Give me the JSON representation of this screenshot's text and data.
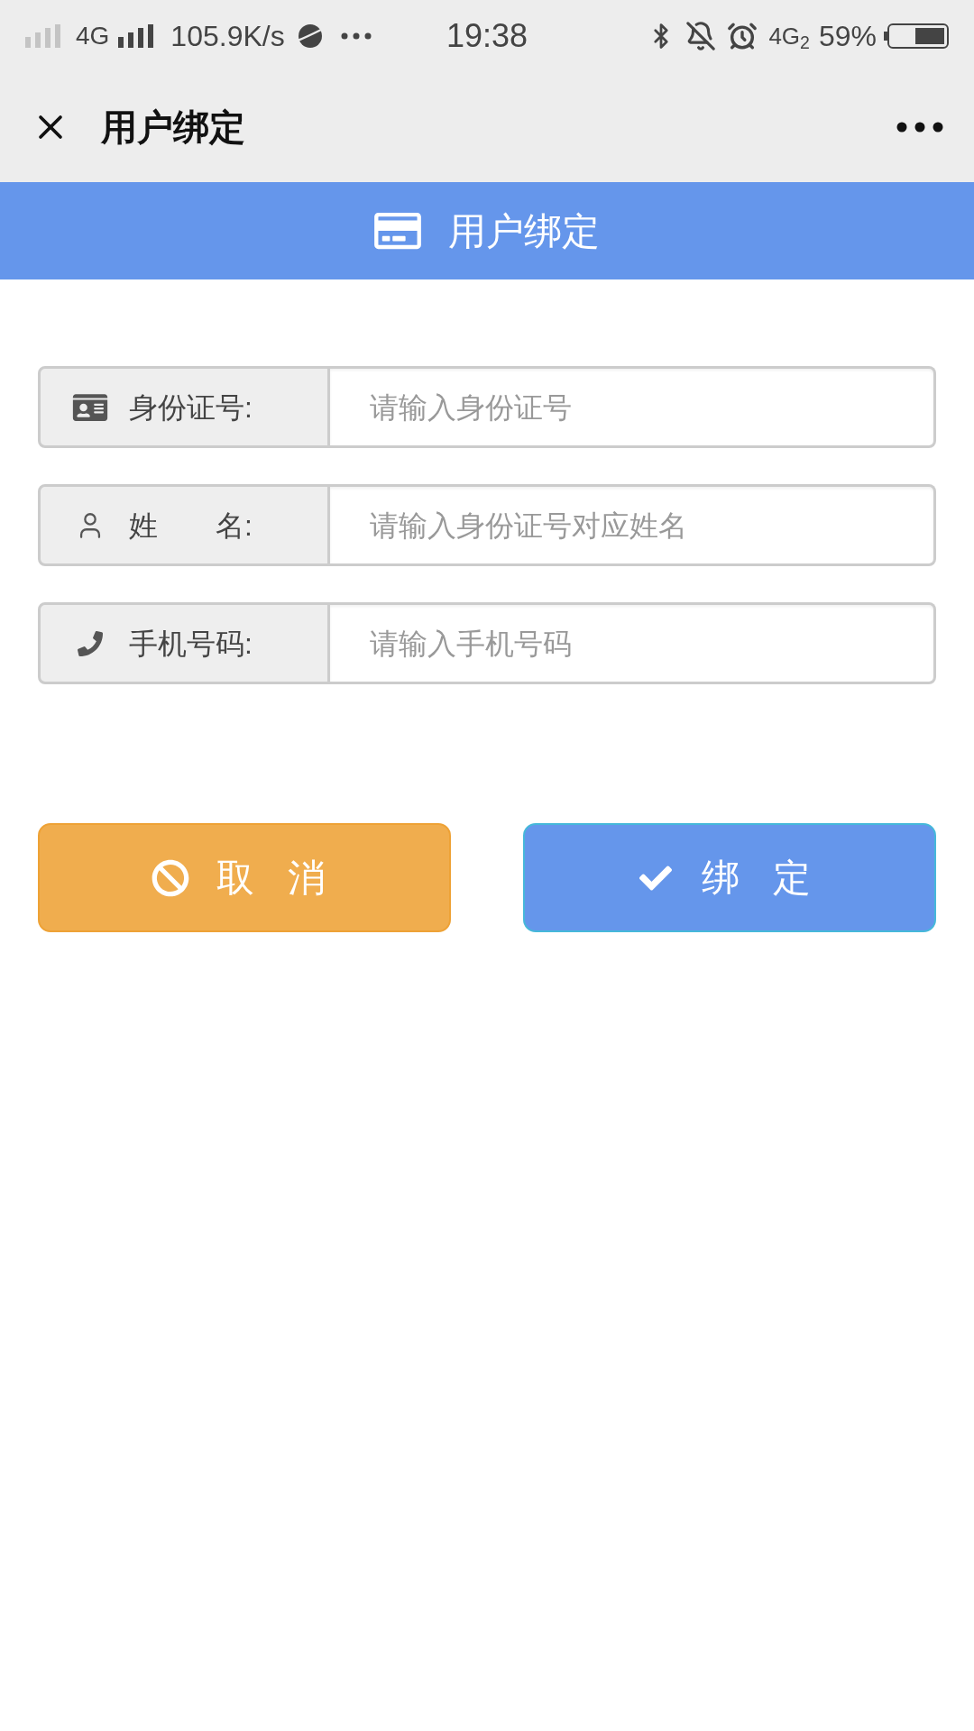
{
  "status_bar": {
    "network_1": "4G",
    "speed": "105.9K/s",
    "time": "19:38",
    "network_2": "4G$_{2}$",
    "battery": "59%"
  },
  "nav_bar": {
    "title": "用户绑定"
  },
  "header": {
    "title": "用户绑定"
  },
  "form": {
    "fields": [
      {
        "kind": "id_card",
        "label": "身份证号:",
        "placeholder": "请输入身份证号"
      },
      {
        "kind": "person",
        "label": "姓　　名:",
        "placeholder": "请输入身份证号对应姓名"
      },
      {
        "kind": "phone",
        "label": "手机号码:",
        "placeholder": "请输入手机号码"
      }
    ]
  },
  "buttons": [
    {
      "kind": "cancel",
      "label": "取 消"
    },
    {
      "kind": "confirm",
      "label": "绑 定"
    }
  ]
}
